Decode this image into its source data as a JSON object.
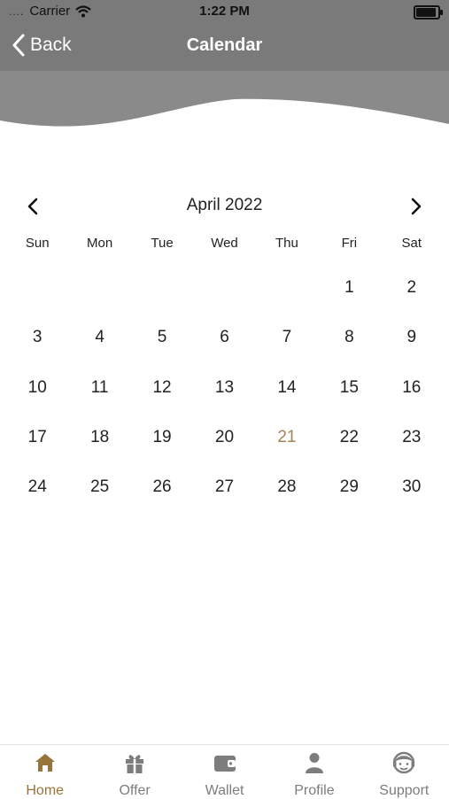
{
  "status_bar": {
    "carrier": "Carrier",
    "time": "1:22 PM",
    "battery_level": 1.0
  },
  "nav": {
    "back_label": "Back",
    "title": "Calendar"
  },
  "calendar": {
    "month_label": "April 2022",
    "weekdays": [
      "Sun",
      "Mon",
      "Tue",
      "Wed",
      "Thu",
      "Fri",
      "Sat"
    ],
    "leading_blanks": 5,
    "days": [
      "1",
      "2",
      "3",
      "4",
      "5",
      "6",
      "7",
      "8",
      "9",
      "10",
      "11",
      "12",
      "13",
      "14",
      "15",
      "16",
      "17",
      "18",
      "19",
      "20",
      "21",
      "22",
      "23",
      "24",
      "25",
      "26",
      "27",
      "28",
      "29",
      "30"
    ],
    "highlighted_day": "21",
    "highlight_color": "#a08656"
  },
  "tabs": [
    {
      "label": "Home",
      "icon": "home-icon",
      "active": true
    },
    {
      "label": "Offer",
      "icon": "gift-icon",
      "active": false
    },
    {
      "label": "Wallet",
      "icon": "wallet-icon",
      "active": false
    },
    {
      "label": "Profile",
      "icon": "profile-icon",
      "active": false
    },
    {
      "label": "Support",
      "icon": "support-icon",
      "active": false
    }
  ],
  "colors": {
    "header_bg": "#7a7a7a",
    "active_tab": "#97753a",
    "inactive_tab": "#7d7d7d"
  }
}
